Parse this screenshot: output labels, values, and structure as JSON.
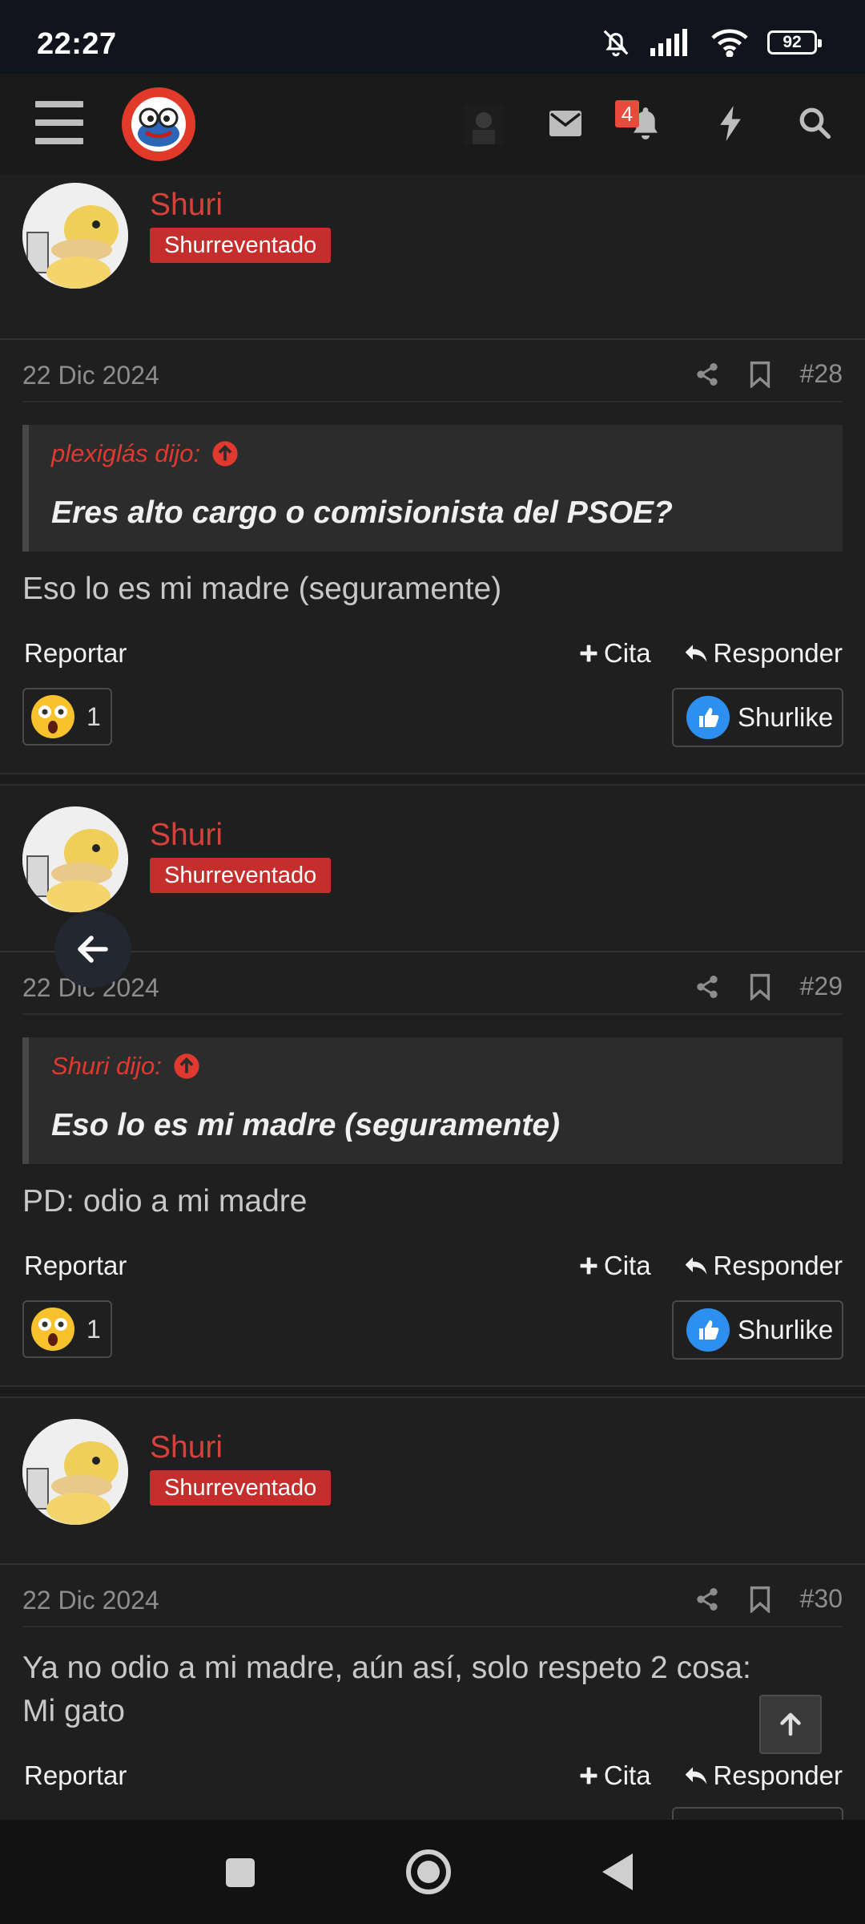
{
  "status_bar": {
    "time": "22:27",
    "battery": "92"
  },
  "header": {
    "menu_icon": "hamburger-icon",
    "logo": "site-logo",
    "icons": [
      "user-avatar",
      "envelope-icon",
      "bell-icon",
      "bolt-icon",
      "search-icon"
    ],
    "notification_count": "4"
  },
  "posts": [
    {
      "user": "Shuri",
      "user_title": "Shurreventado",
      "date": "22 Dic 2024",
      "number": "#28",
      "quote_author": "plexiglás dijo:",
      "quote_text": "Eres alto cargo o comisionista del PSOE?",
      "text": "Eso lo es mi madre (seguramente)",
      "report": "Reportar",
      "quote_btn": "Cita",
      "reply_btn": "Responder",
      "reaction_count": "1",
      "like_label": "Shurlike"
    },
    {
      "user": "Shuri",
      "user_title": "Shurreventado",
      "date": "22 Dic 2024",
      "number": "#29",
      "quote_author": "Shuri dijo:",
      "quote_text": "Eso lo es mi madre (seguramente)",
      "text": "PD: odio a mi madre",
      "report": "Reportar",
      "quote_btn": "Cita",
      "reply_btn": "Responder",
      "reaction_count": "1",
      "like_label": "Shurlike"
    },
    {
      "user": "Shuri",
      "user_title": "Shurreventado",
      "date": "22 Dic 2024",
      "number": "#30",
      "text_line1": "Ya no odio a mi madre, aún así, solo respeto 2 cosa:",
      "text_line2": "Mi gato",
      "report": "Reportar",
      "quote_btn": "Cita",
      "reply_btn": "Responder"
    }
  ],
  "colors": {
    "accent": "#d6423b",
    "badge": "#c62d2d",
    "background": "#1f1f1f",
    "quote_author": "#e1392f"
  }
}
